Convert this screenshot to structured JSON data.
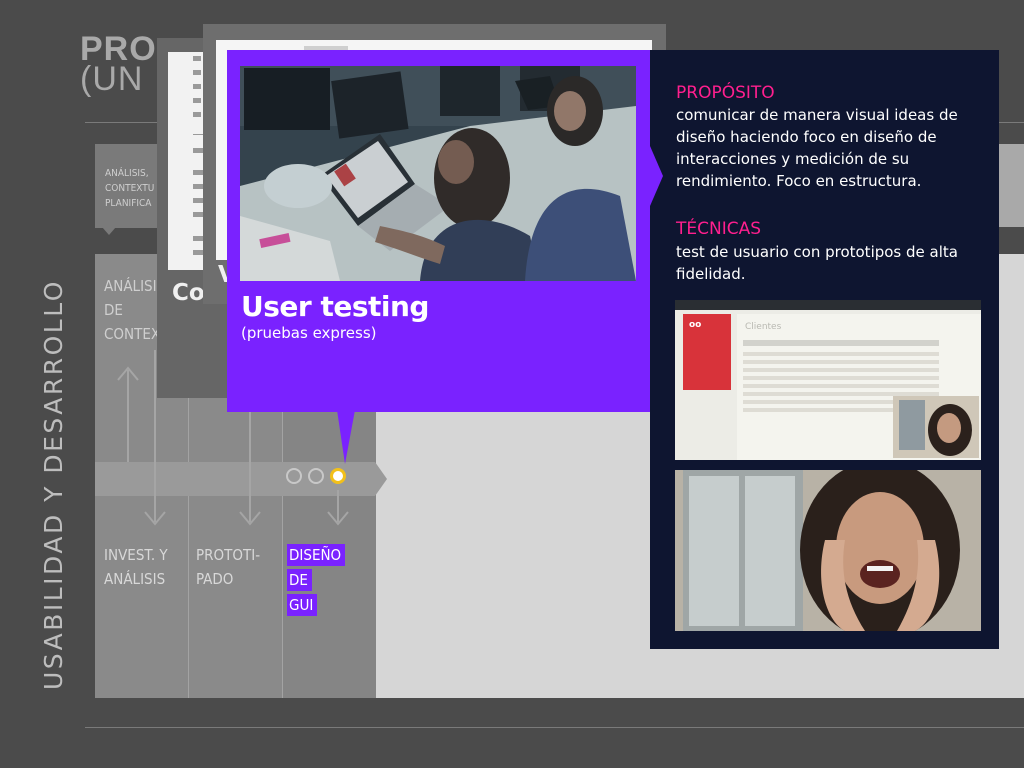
{
  "background": {
    "title_line1": "PRO",
    "title_line2": "(UN",
    "vertical_label": "USABILIDAD Y DESARROLLO",
    "top_box_text": "ANÁLISIS,\nCONTEXTU\nPLANIFICA",
    "top_column_label": "ANÁLISI\nDE\nCONTEX",
    "columns": [
      {
        "label_lines": [
          "INVEST. Y",
          "ANÁLISIS"
        ]
      },
      {
        "label_lines": [
          "PROTOTI-",
          "PADO"
        ]
      },
      {
        "label_lines": [
          "DISEÑO",
          "DE",
          "GUI"
        ],
        "highlighted": true
      }
    ],
    "stacked_cards": [
      {
        "title_visible": "Co"
      },
      {
        "title_visible": "V"
      }
    ]
  },
  "card": {
    "title": "User testing",
    "subtitle": "(pruebas express)",
    "photo": "people-testing-laptop-photo"
  },
  "info_panel": {
    "purpose_heading": "PROPÓSITO",
    "purpose_text": "comunicar de manera visual ideas de diseño haciendo foco en diseño de interacciones y medición de su rendimiento. Foco en estructura.",
    "techniques_heading": "TÉCNICAS",
    "techniques_text": "test de usuario con prototipos de alta fidelidad.",
    "screenshot_app_title": "Clientes",
    "screenshot_label": "oo",
    "images": [
      "app-screenshot-with-webcam",
      "laughing-user-photo"
    ]
  },
  "colors": {
    "accent_purple": "#7a22ff",
    "navy": "#0e1530",
    "heading_pink": "#ff1f8e",
    "active_dot": "#f2c01a"
  }
}
